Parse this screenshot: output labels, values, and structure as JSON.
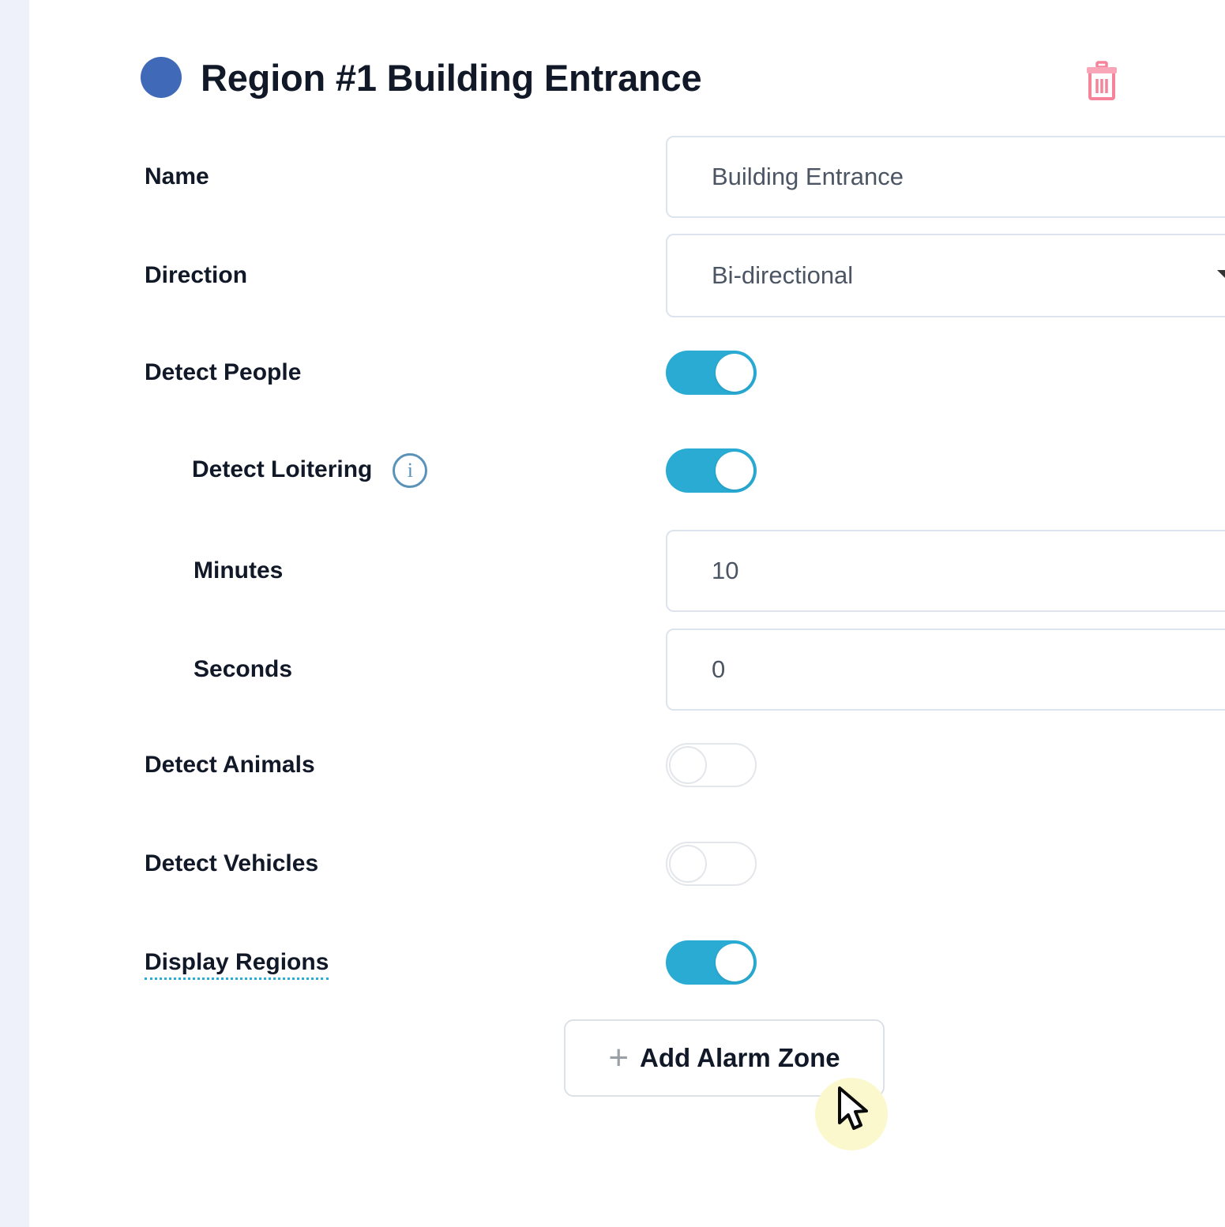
{
  "header": {
    "region_dot_color": "#4069b8",
    "title": "Region #1 Building Entrance",
    "delete_icon": "trash-icon",
    "delete_icon_color": "#f5849b"
  },
  "form": {
    "name": {
      "label": "Name",
      "value": "Building Entrance",
      "placeholder": "Name"
    },
    "direction": {
      "label": "Direction",
      "value": "Bi-directional",
      "caret_icon": "chevron-down-icon"
    },
    "detect_people": {
      "label": "Detect People",
      "state": "on"
    },
    "detect_loitering": {
      "label": "Detect Loitering",
      "info_icon": "info-icon",
      "info_glyph": "i",
      "state": "on"
    },
    "minutes": {
      "label": "Minutes",
      "value": "10",
      "placeholder": "Minutes"
    },
    "seconds": {
      "label": "Seconds",
      "value": "0",
      "placeholder": "Seconds"
    },
    "detect_animals": {
      "label": "Detect Animals",
      "state": "off"
    },
    "detect_vehicles": {
      "label": "Detect Vehicles",
      "state": "off"
    },
    "display_regions": {
      "label": "Display Regions",
      "state": "on"
    }
  },
  "actions": {
    "add_alarm_zone": {
      "label": "Add Alarm Zone",
      "plus_icon": "plus-icon",
      "plus_glyph": "+"
    }
  },
  "colors": {
    "toggle_on": "#29abd4",
    "accent_blue": "#4069b8",
    "danger": "#f5849b",
    "gutter": "#eef1f9",
    "border": "#dde3ef"
  }
}
